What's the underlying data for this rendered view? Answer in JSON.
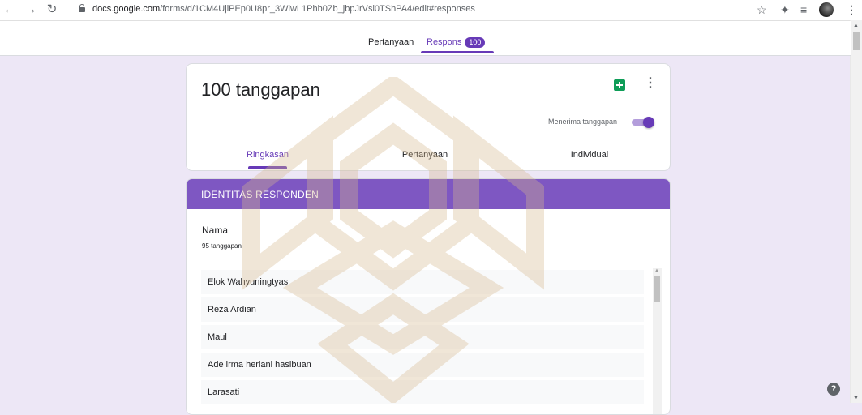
{
  "browser": {
    "url_host": "docs.google.com",
    "url_path": "/forms/d/1CM4UjiPEp0U8pr_3WiwL1Phb0Zb_jbpJrVsl0TShPA4/edit#responses",
    "icons": [
      "back-icon",
      "forward-icon",
      "reload-icon",
      "lock-icon",
      "star-icon",
      "extensions-icon",
      "reading-list-icon",
      "profile-avatar",
      "kebab-menu-icon"
    ]
  },
  "form_tabs": {
    "questions_label": "Pertanyaan",
    "responses_label": "Respons",
    "responses_count": "100"
  },
  "summary": {
    "title": "100 tanggapan",
    "accepting_label": "Menerima tanggapan",
    "accepting_on": true,
    "tabs": [
      "Ringkasan",
      "Pertanyaan",
      "Individual"
    ],
    "active_tab": "Ringkasan"
  },
  "section": {
    "title": "IDENTITAS RESPONDEN",
    "question": {
      "title": "Nama",
      "count": "95 tanggapan",
      "answers": [
        "Elok Wahyuningtyas",
        "Reza Ardian",
        "Maul",
        "Ade irma heriani hasibuan",
        "Larasati"
      ]
    }
  },
  "colors": {
    "accent": "#673ab7",
    "section_header": "#7e57c2",
    "page_bg": "#ede7f6",
    "sheets_green": "#0f9d58",
    "watermark": "#d7b98e"
  },
  "help": {
    "icon": "help-icon",
    "label": "?"
  }
}
